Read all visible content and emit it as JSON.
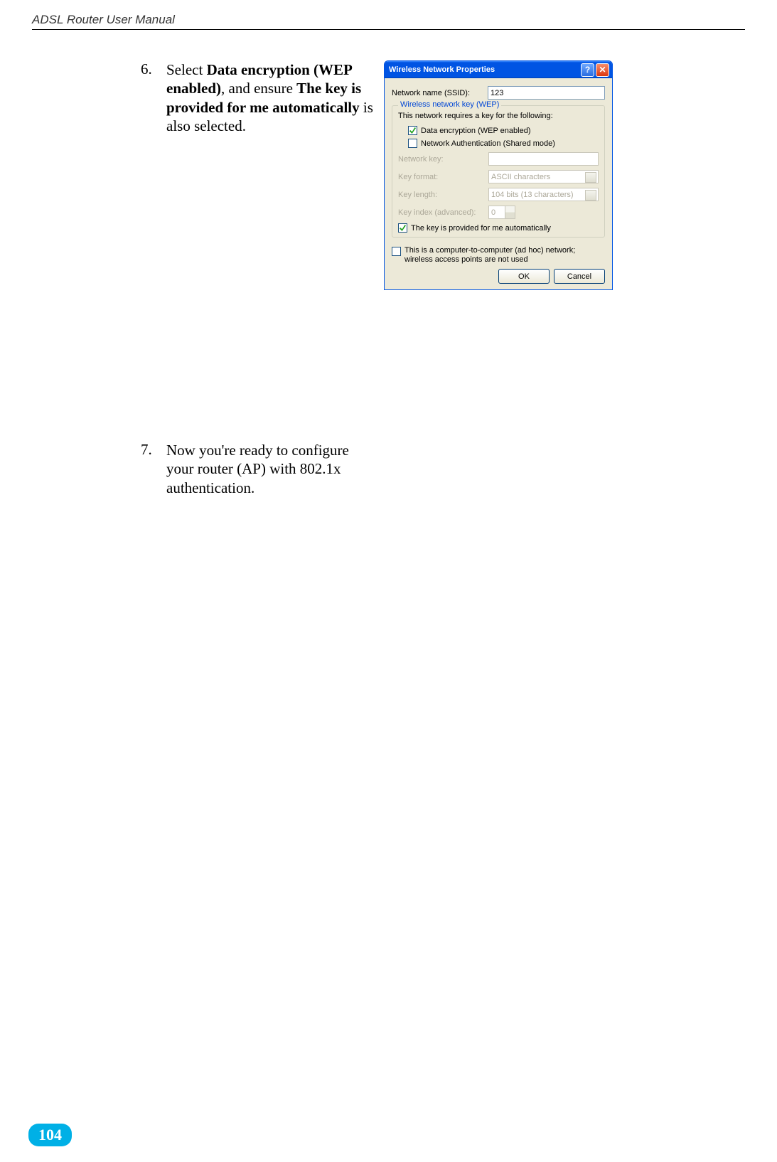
{
  "header": "ADSL Router User Manual",
  "page_number": "104",
  "steps": {
    "six": {
      "num": "6.",
      "pre": "Select ",
      "bold1": "Data encryption (WEP enabled)",
      "mid": ", and ensure ",
      "bold2": "The key is provided for me automatically",
      "post": " is also selected."
    },
    "seven": {
      "num": "7.",
      "text": "Now you're ready to configure your router (AP) with 802.1x authentication."
    }
  },
  "dialog": {
    "title": "Wireless Network Properties",
    "ssid_label": "Network name (SSID):",
    "ssid_value": "123",
    "fieldset_title": "Wireless network key (WEP)",
    "intro": "This network requires a key for the following:",
    "cb_data_enc": "Data encryption (WEP enabled)",
    "cb_net_auth": "Network Authentication (Shared mode)",
    "key_label": "Network key:",
    "fmt_label": "Key format:",
    "fmt_value": "ASCII characters",
    "len_label": "Key length:",
    "len_value": "104 bits (13 characters)",
    "idx_label": "Key index (advanced):",
    "idx_value": "0",
    "auto_label": "The key is provided for me automatically",
    "adhoc": "This is a computer-to-computer (ad hoc) network; wireless access points are not used",
    "ok": "OK",
    "cancel": "Cancel"
  }
}
